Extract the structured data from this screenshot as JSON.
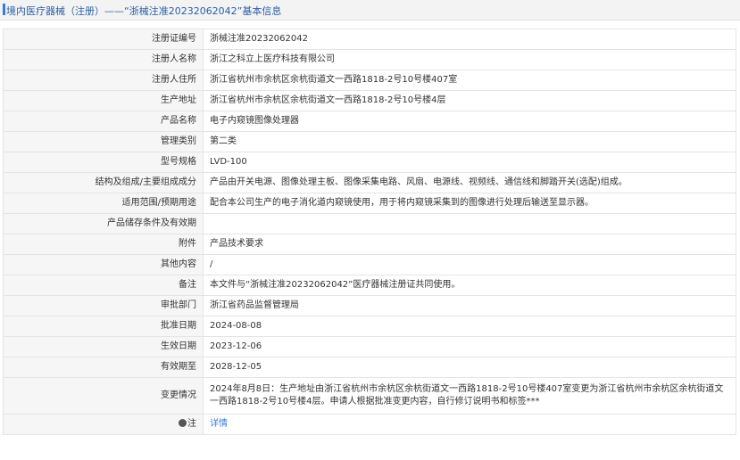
{
  "header": {
    "title": "境内医疗器械（注册）——“浙械注准20232062042”基本信息"
  },
  "rows": [
    {
      "label": "注册证编号",
      "value": "浙械注准20232062042"
    },
    {
      "label": "注册人名称",
      "value": "浙江之科立上医疗科技有限公司"
    },
    {
      "label": "注册人住所",
      "value": "浙江省杭州市余杭区余杭街道文一西路1818-2号10号楼407室"
    },
    {
      "label": "生产地址",
      "value": "浙江省杭州市余杭区余杭街道文一西路1818-2号10号楼4层"
    },
    {
      "label": "产品名称",
      "value": "电子内窥镜图像处理器"
    },
    {
      "label": "管理类别",
      "value": "第二类"
    },
    {
      "label": "型号规格",
      "value": "LVD-100"
    },
    {
      "label": "结构及组成/主要组成成分",
      "value": "产品由开关电源、图像处理主板、图像采集电路、风扇、电源线、视频线、通信线和脚踏开关(选配)组成。"
    },
    {
      "label": "适用范围/预期用途",
      "value": "配合本公司生产的电子消化道内窥镜使用，用于将内窥镜采集到的图像进行处理后输送至显示器。"
    },
    {
      "label": "产品储存条件及有效期",
      "value": ""
    },
    {
      "label": "附件",
      "value": "产品技术要求"
    },
    {
      "label": "其他内容",
      "value": "/"
    },
    {
      "label": "备注",
      "value": "本文件与“浙械注准20232062042”医疗器械注册证共同使用。"
    },
    {
      "label": "审批部门",
      "value": "浙江省药品监督管理局"
    },
    {
      "label": "批准日期",
      "value": "2024-08-08"
    },
    {
      "label": "生效日期",
      "value": "2023-12-06"
    },
    {
      "label": "有效期至",
      "value": "2028-12-05"
    },
    {
      "label": "变更情况",
      "value": "2024年8月8日：生产地址由浙江省杭州市余杭区余杭街道文一西路1818-2号10号楼407室变更为浙江省杭州市余杭区余杭街道文一西路1818-2号10号楼4层。申请人根据批准变更内容，自行修订说明书和标签***"
    }
  ],
  "footer": {
    "label": "注",
    "link": "详情",
    "icon": "info-icon"
  }
}
